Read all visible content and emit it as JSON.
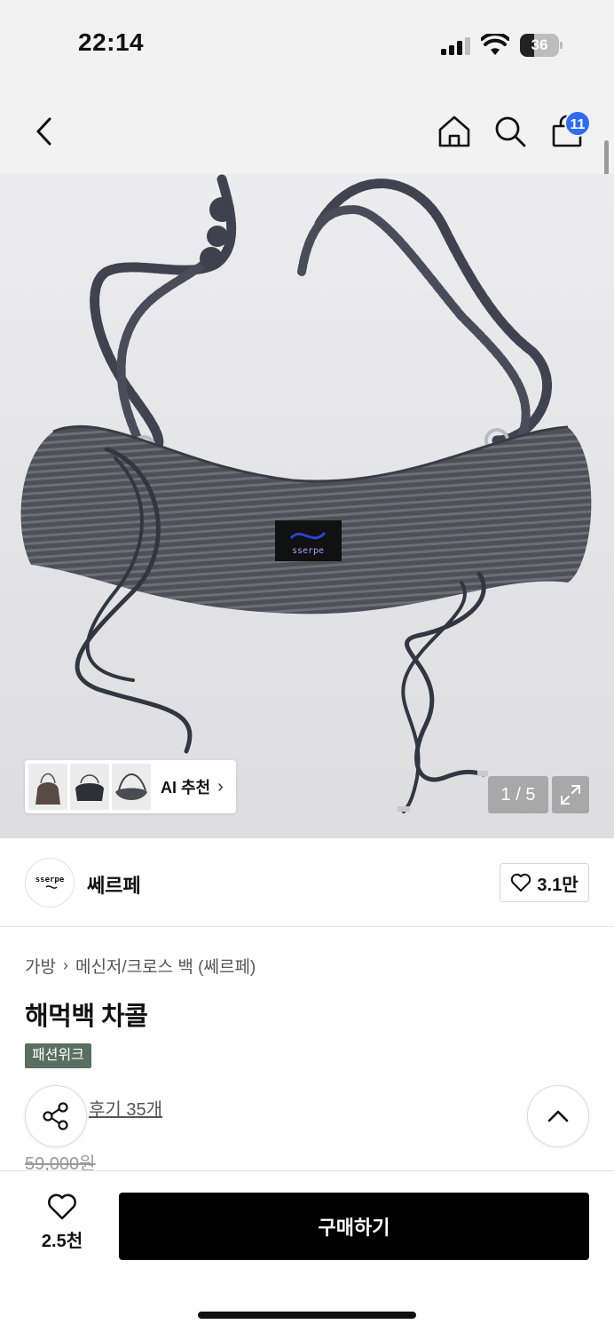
{
  "status_bar": {
    "time": "22:14",
    "battery": "36",
    "battery_level": 0.36
  },
  "header": {
    "back_icon": "chevron-left-icon",
    "home_icon": "home-icon",
    "search_icon": "search-icon",
    "cart_icon": "shopping-bag-icon",
    "cart_badge": "11",
    "badge_color": "#2f6cf6"
  },
  "gallery": {
    "ai_recommend_label": "AI 추천",
    "counter": "1 / 5",
    "expand_icon": "expand-icon",
    "brand_tag_text": "sserpe"
  },
  "brand": {
    "logo_text": "sserpe",
    "name": "쎄르페",
    "like_count": "3.1만"
  },
  "breadcrumb": {
    "items": [
      "가방",
      "메신저/크로스 백 (쎄르페)"
    ]
  },
  "product": {
    "title": "해먹백 차콜",
    "badge": "패션위크",
    "badge_color": "#5a6e62",
    "reviews": "후기 35개",
    "original_price": "59,000원"
  },
  "bottom_bar": {
    "wish_count": "2.5천",
    "buy_label": "구매하기"
  }
}
